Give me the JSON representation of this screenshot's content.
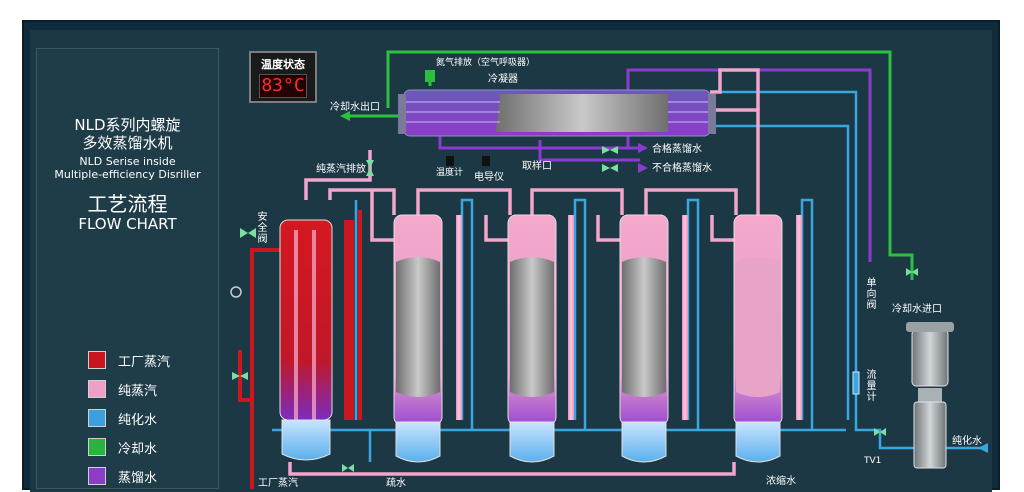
{
  "title": {
    "cn_line1": "NLD系列内螺旋",
    "cn_line2": "多效蒸馏水机",
    "en_line1": "NLD Serise inside",
    "en_line2": "Multiple-efficiency Disriller",
    "flow_cn": "工艺流程",
    "flow_en": "FLOW CHART"
  },
  "legend": [
    {
      "label": "工厂蒸汽",
      "color": "#c8141e"
    },
    {
      "label": "纯蒸汽",
      "color": "#f0a0c8"
    },
    {
      "label": "纯化水",
      "color": "#3ca0dc"
    },
    {
      "label": "冷却水",
      "color": "#28b43c"
    },
    {
      "label": "蒸馏水",
      "color": "#8c3cc8"
    }
  ],
  "temperature": {
    "title": "温度状态",
    "value": "83°C"
  },
  "labels": {
    "nitrogen_exhaust": "氮气排放（空气呼吸器）",
    "condenser": "冷凝器",
    "cooling_water_outlet": "冷却水出口",
    "pure_steam_exhaust": "纯蒸汽排放",
    "thermometer": "温度计",
    "conductivity_meter": "电导仪",
    "sampling_port": "取样口",
    "qualified_water": "合格蒸馏水",
    "unqualified_water": "不合格蒸馏水",
    "safety_valve": "安全阀",
    "check_valve": "单向阀",
    "cooling_water_inlet": "冷却水进口",
    "flow_meter": "流量计",
    "purified_water": "纯化水",
    "concentrate": "浓缩水",
    "factory_steam": "工厂蒸汽",
    "drain": "疏水",
    "tv1": "TV1"
  }
}
